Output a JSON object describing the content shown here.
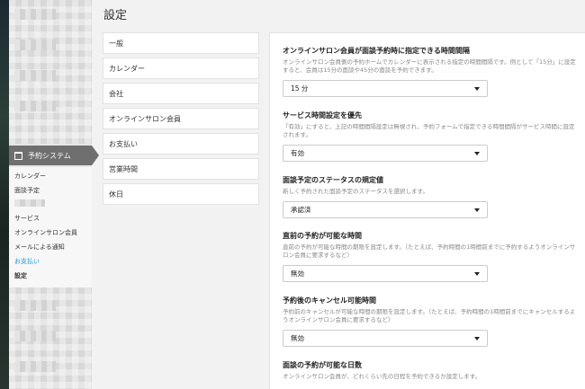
{
  "page": {
    "title": "設定"
  },
  "sidebar": {
    "system_label": "予約システム",
    "items": [
      {
        "label": "カレンダー",
        "style": "normal"
      },
      {
        "label": "面談予定",
        "style": "normal"
      },
      {
        "label": "サービス",
        "style": "normal"
      },
      {
        "label": "オンラインサロン会員",
        "style": "normal"
      },
      {
        "label": "メールによる通知",
        "style": "normal"
      },
      {
        "label": "お支払い",
        "style": "link"
      },
      {
        "label": "設定",
        "style": "bold"
      }
    ]
  },
  "settings_nav": [
    "一般",
    "カレンダー",
    "会社",
    "オンラインサロン会員",
    "お支払い",
    "営業時間",
    "休日"
  ],
  "settings": [
    {
      "title": "オンラインサロン会員が面談予約時に指定できる時間間隔",
      "description": "オンラインサロン会員側の予約ホームでカレンダーに表示される指定の時間間隔です。例として「15分」に設定すると、会員は15分の面談や45分の面談を予約できます。",
      "value": "15 分"
    },
    {
      "title": "サービス時間設定を優先",
      "description": "「有効」にすると、上記の時間間隔設定は無視され、予約フォームで指定できる時間間隔がサービス時間に設定されます。",
      "value": "有効"
    },
    {
      "title": "面談予定のステータスの規定値",
      "description": "新しく予約された面談予定のステータスを選択します。",
      "value": "承認済"
    },
    {
      "title": "直前の予約が可能な時間",
      "description": "直前の予約が可能な時間の期限を設定します。（たとえば、予約時間の1時間前までに予約するようオンラインサロン会員に要求するなど）",
      "value": "無効"
    },
    {
      "title": "予約後のキャンセル可能時間",
      "description": "予約前のキャンセルが可能な時間の期限を設定します。（たとえば、予約時間の1時間前までにキャンセルするようオンラインサロン会員に要求するなど）",
      "value": "無効"
    },
    {
      "title": "面談の予約が可能な日数",
      "description": "オンラインサロン会員が、どれくらい先の日程を予約できるか設定します。",
      "value": ""
    }
  ]
}
